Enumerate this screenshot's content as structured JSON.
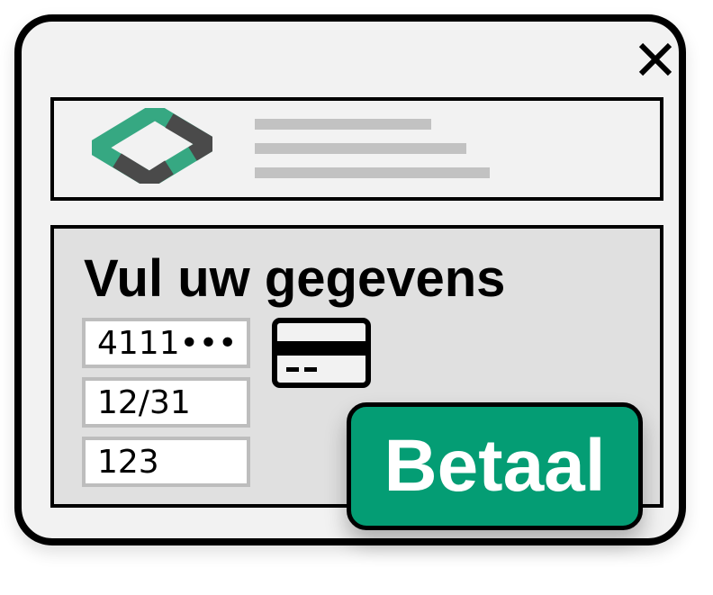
{
  "form": {
    "title": "Vul uw gegevens",
    "card_number": "4111•••",
    "expiry": "12/31",
    "cvc": "123"
  },
  "actions": {
    "pay_label": "Betaal",
    "close_icon": "close-icon"
  },
  "header": {
    "logo_icon": "logo-icon"
  },
  "icons": {
    "card": "credit-card-icon"
  },
  "colors": {
    "brand_green": "#049d74",
    "logo_green": "#36a882",
    "logo_dark": "#4a4a4a",
    "placeholder_line": "#c2c2c2",
    "form_background": "#e0e0e0",
    "window_background": "#f2f2f2"
  }
}
